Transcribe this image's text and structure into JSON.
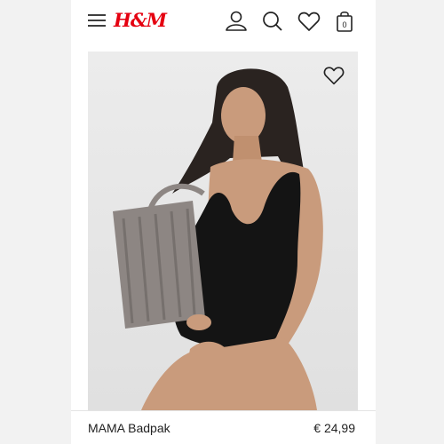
{
  "header": {
    "brand": "H&M",
    "icons": {
      "menu": "hamburger-menu-icon",
      "account": "user-icon",
      "search": "search-icon",
      "favorites": "heart-icon",
      "bag": "shopping-bag-icon"
    },
    "bag_count": "0",
    "brand_color": "#e50010"
  },
  "product": {
    "favorite_icon": "heart-outline-icon",
    "name": "MAMA Badpak",
    "price": "€ 24,99"
  }
}
